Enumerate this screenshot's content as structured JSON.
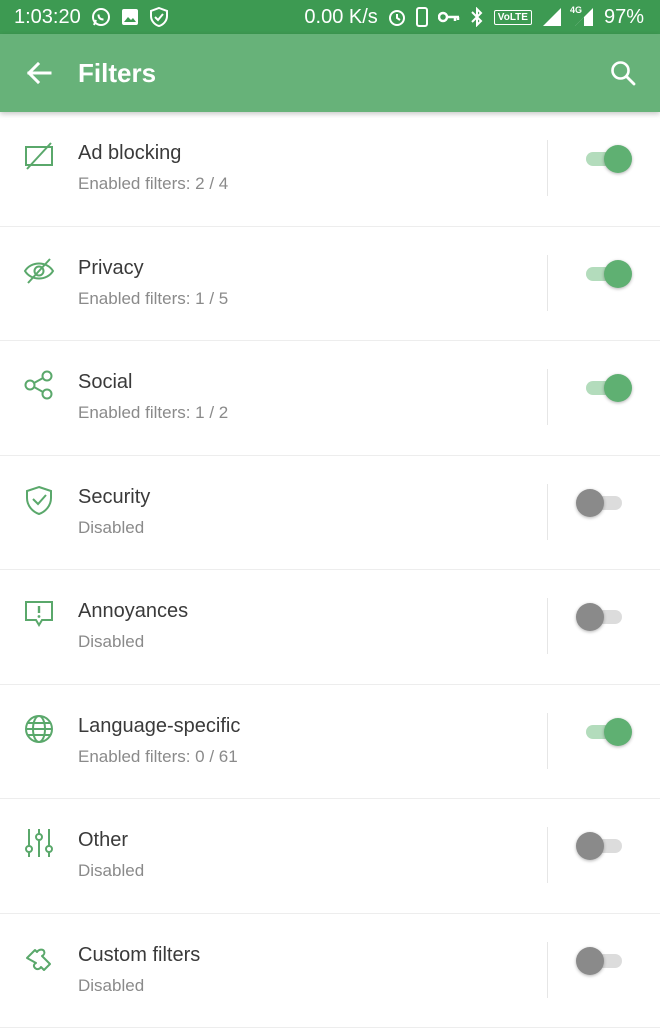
{
  "status_bar": {
    "time": "1:03:20",
    "speed": "0.00 K/s",
    "volte": "VoLTE",
    "network": "4G",
    "battery": "97%"
  },
  "app_bar": {
    "title": "Filters"
  },
  "colors": {
    "status_bar": "#3d9a52",
    "app_bar": "#67b279",
    "accent": "#5fb072",
    "icon": "#5aa86b"
  },
  "filters": [
    {
      "icon": "ad-blocking-icon",
      "title": "Ad blocking",
      "subtitle": "Enabled filters: 2 / 4",
      "enabled": true
    },
    {
      "icon": "privacy-icon",
      "title": "Privacy",
      "subtitle": "Enabled filters: 1 / 5",
      "enabled": true
    },
    {
      "icon": "social-icon",
      "title": "Social",
      "subtitle": "Enabled filters: 1 / 2",
      "enabled": true
    },
    {
      "icon": "security-shield-icon",
      "title": "Security",
      "subtitle": "Disabled",
      "enabled": false
    },
    {
      "icon": "annoyances-icon",
      "title": "Annoyances",
      "subtitle": "Disabled",
      "enabled": false
    },
    {
      "icon": "globe-icon",
      "title": "Language-specific",
      "subtitle": "Enabled filters: 0 / 61",
      "enabled": true
    },
    {
      "icon": "sliders-icon",
      "title": "Other",
      "subtitle": "Disabled",
      "enabled": false
    },
    {
      "icon": "puzzle-icon",
      "title": "Custom filters",
      "subtitle": "Disabled",
      "enabled": false
    }
  ]
}
